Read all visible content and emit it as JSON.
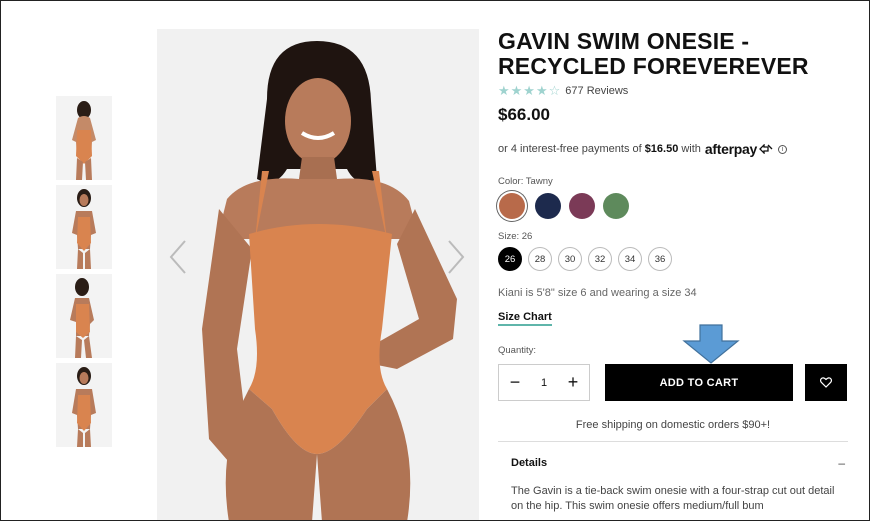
{
  "product": {
    "title": "GAVIN SWIM ONESIE - RECYCLED FOREVEREVER",
    "stars": "★★★★☆",
    "reviews": "677 Reviews",
    "price": "$66.00"
  },
  "afterpay": {
    "prefix": "or 4 interest-free payments of",
    "amount": "$16.50",
    "suffix": "with",
    "logo": "afterpay",
    "info_icon": "i"
  },
  "color": {
    "label": "Color: Tawny",
    "swatches": [
      {
        "name": "Tawny",
        "hex": "#b86a4a",
        "selected": true
      },
      {
        "name": "Navy",
        "hex": "#1d2a4d",
        "selected": false
      },
      {
        "name": "Plum",
        "hex": "#7b3a57",
        "selected": false
      },
      {
        "name": "Green",
        "hex": "#5e8a5c",
        "selected": false
      }
    ]
  },
  "size": {
    "label": "Size: 26",
    "options": [
      "26",
      "28",
      "30",
      "32",
      "34",
      "36"
    ],
    "selected": "26"
  },
  "model_note": "Kiani is 5'8\" size 6 and wearing a size 34",
  "size_chart": "Size Chart",
  "quantity": {
    "label": "Quantity:",
    "value": "1",
    "minus": "−",
    "plus": "+"
  },
  "add_to_cart": "ADD TO CART",
  "wishlist_icon": "heart-icon",
  "shipping": "Free shipping on domestic orders $90+!",
  "details": {
    "title": "Details",
    "toggle": "–",
    "body": "The Gavin is a tie-back swim onesie with a four-strap cut out detail on the hip. This swim onesie offers medium/full bum"
  },
  "colors": {
    "accent": "#5fb5aa",
    "star": "#9fd3cf",
    "swimsuit": "#d9844f",
    "annotation_arrow": "#5b9bd5"
  }
}
